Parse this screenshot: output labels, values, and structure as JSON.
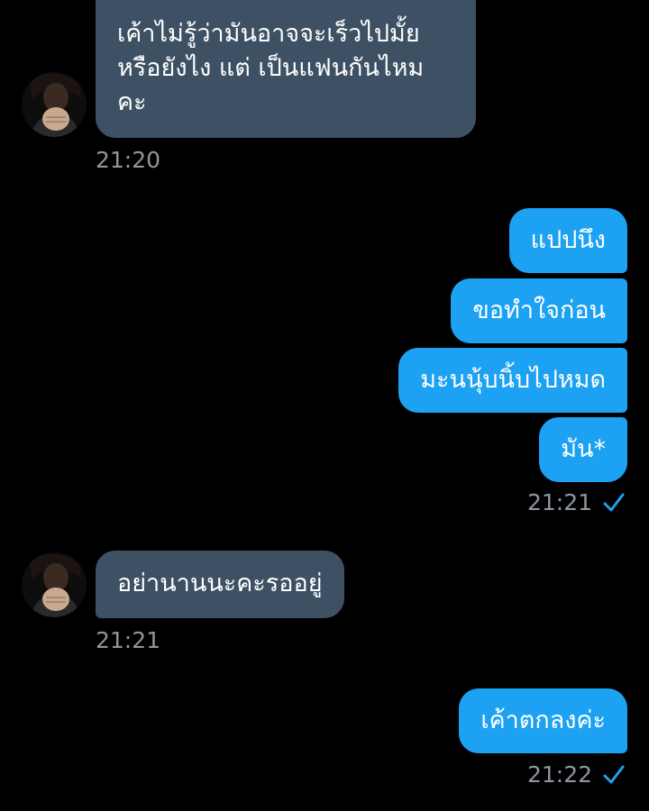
{
  "colors": {
    "background": "#000000",
    "incoming_bubble": "#3e5164",
    "outgoing_bubble": "#1da1f2",
    "timestamp": "#8e979f",
    "read_check": "#1da1f2"
  },
  "messages": {
    "m1": {
      "direction": "incoming",
      "lines": [
        "เค้าไม่รู้ว่ามันอาจจะเร็วไปมั้ย",
        "หรือยังไง แต่ เป็นแฟนกันไหม",
        "คะ"
      ],
      "time": "21:20",
      "avatar_icon": "contact-avatar"
    },
    "m2": {
      "direction": "outgoing",
      "text": "แปปนึง"
    },
    "m3": {
      "direction": "outgoing",
      "text": "ขอทำใจก่อน"
    },
    "m4": {
      "direction": "outgoing",
      "text": "มะนนุ้บนิ้บไปหมด"
    },
    "m5": {
      "direction": "outgoing",
      "text": "มัน*",
      "time": "21:21",
      "status_icon": "read-check-icon"
    },
    "m6": {
      "direction": "incoming",
      "text": "อย่านานนะคะรออยู่",
      "time": "21:21",
      "avatar_icon": "contact-avatar"
    },
    "m7": {
      "direction": "outgoing",
      "text": "เค้าตกลงค่ะ",
      "time": "21:22",
      "status_icon": "read-check-icon"
    }
  }
}
